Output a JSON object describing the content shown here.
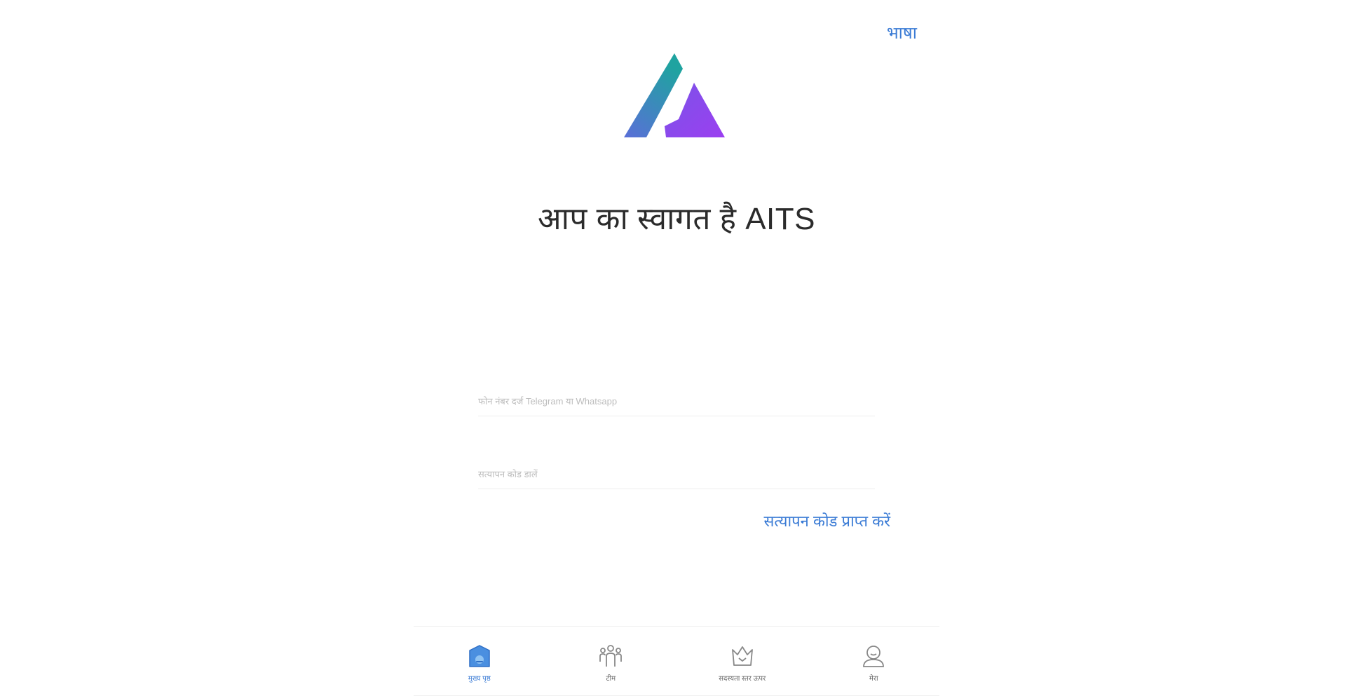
{
  "header": {
    "language_label": "भाषा"
  },
  "hero": {
    "welcome_text": "आप का स्वागत है AITS"
  },
  "form": {
    "phone_placeholder": "फोन नंबर दर्ज Telegram या Whatsapp",
    "code_placeholder": "सत्यापन कोड डालें",
    "get_code_label": "सत्यापन कोड प्राप्त करें"
  },
  "tabbar": {
    "items": [
      {
        "label": "मुख्य पृष्ठ",
        "icon": "home-icon",
        "active": true
      },
      {
        "label": "टीम",
        "icon": "team-icon",
        "active": false
      },
      {
        "label": "सदस्यता स्तर ऊपर",
        "icon": "crown-icon",
        "active": false
      },
      {
        "label": "मेरा",
        "icon": "user-icon",
        "active": false
      }
    ]
  },
  "colors": {
    "accent": "#3a7bd5",
    "logo_gradient_start": "#1fa3a0",
    "logo_gradient_end": "#9b3ff0"
  }
}
